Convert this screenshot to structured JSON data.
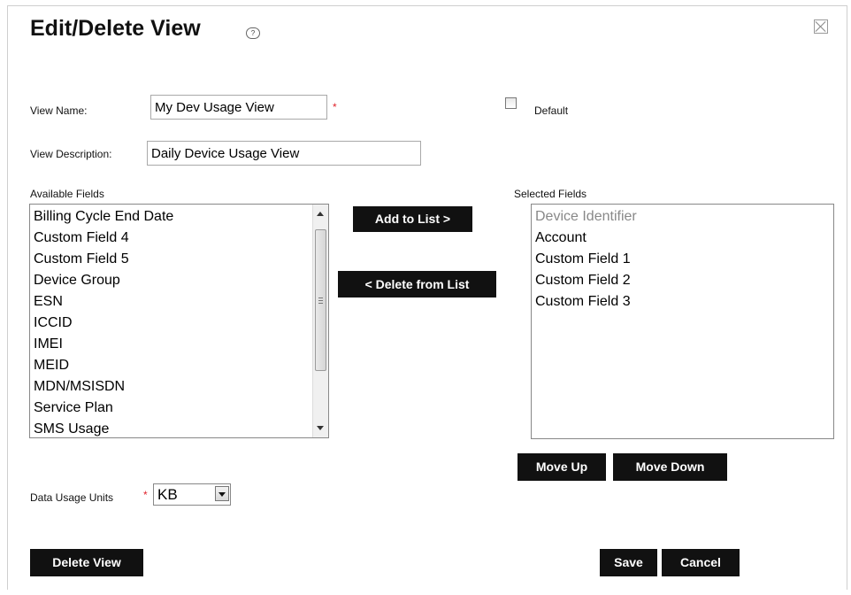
{
  "dialog": {
    "title": "Edit/Delete View",
    "help_icon": "question-mark-icon",
    "close_icon": "close-x-icon",
    "help_glyph": "?"
  },
  "form": {
    "view_name_label": "View Name:",
    "view_name_value": "My Dev Usage View",
    "required_marker": "*",
    "default_label": "Default",
    "default_checked": false,
    "view_description_label": "View Description:",
    "view_description_value": "Daily Device Usage View"
  },
  "available": {
    "label": "Available Fields",
    "items": [
      "Billing Cycle End Date",
      "Custom Field 4",
      "Custom Field 5",
      "Device Group",
      "ESN",
      "ICCID",
      "IMEI",
      "MEID",
      "MDN/MSISDN",
      "Service Plan",
      "SMS Usage"
    ]
  },
  "selected": {
    "label": "Selected Fields",
    "items": [
      {
        "label": "Device Identifier",
        "disabled": true
      },
      {
        "label": "Account",
        "disabled": false
      },
      {
        "label": "Custom Field 1",
        "disabled": false
      },
      {
        "label": "Custom Field 2",
        "disabled": false
      },
      {
        "label": "Custom Field 3",
        "disabled": false
      }
    ]
  },
  "buttons": {
    "add": "Add to List >",
    "remove": "< Delete from List",
    "move_up": "Move Up",
    "move_down": "Move Down",
    "delete_view": "Delete View",
    "save": "Save",
    "cancel": "Cancel"
  },
  "units": {
    "label": "Data Usage Units",
    "value": "KB"
  }
}
